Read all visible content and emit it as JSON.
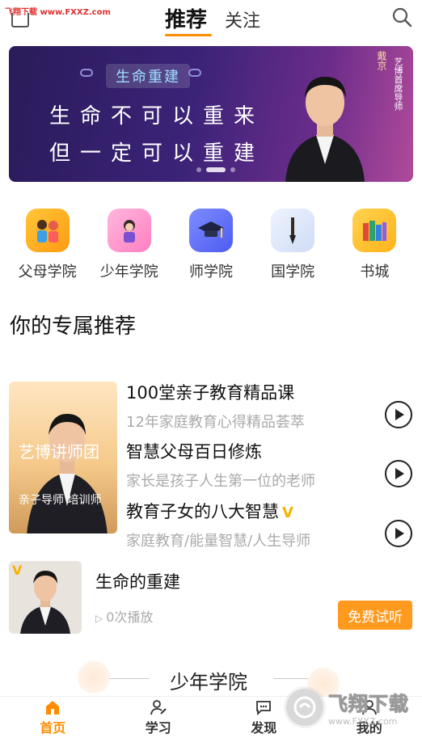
{
  "watermark_top": "飞翔下载 www.FXXZ.com",
  "watermark_bottom": {
    "title": "飞翔下载",
    "url": "www.FXXZ.com"
  },
  "header": {
    "tab_active": "推荐",
    "tab_follow": "关注"
  },
  "banner": {
    "pill": "生命重建",
    "line1": "生命不可以重来",
    "line2": "但一定可以重建",
    "side_name": "戴京",
    "side_title": "艺博首席导师",
    "dots": 3,
    "active_dot": 1
  },
  "categories": [
    {
      "label": "父母学院",
      "icon": "parents-icon",
      "color": "#ffb21e"
    },
    {
      "label": "少年学院",
      "icon": "teen-icon",
      "color": "#ff9ad0"
    },
    {
      "label": "师学院",
      "icon": "graduation-cap-icon",
      "color": "#6a7bff"
    },
    {
      "label": "国学院",
      "icon": "brush-icon",
      "color": "#dce9ff"
    },
    {
      "label": "书城",
      "icon": "books-icon",
      "color": "#ffc53a"
    }
  ],
  "recommend": {
    "title": "你的专属推荐",
    "teacher": {
      "name": "艺博讲师团",
      "desc": "亲子导师 培训师"
    },
    "courses": [
      {
        "title": "100堂亲子教育精品课",
        "subtitle": "12年家庭教育心得精品荟萃",
        "vip": ""
      },
      {
        "title": "智慧父母百日修炼",
        "subtitle": "家长是孩子人生第一位的老师",
        "vip": ""
      },
      {
        "title": "教育子女的八大智慧",
        "subtitle": "家庭教育/能量智慧/人生导师",
        "vip": "V"
      }
    ]
  },
  "life_course": {
    "badge": "V",
    "title": "生命的重建",
    "plays": "0次播放",
    "trial_button": "免费试听"
  },
  "sub_section_title": "少年学院",
  "bottom_nav": [
    {
      "label": "首页",
      "icon": "home-icon",
      "active": true
    },
    {
      "label": "学习",
      "icon": "study-icon",
      "active": false
    },
    {
      "label": "发现",
      "icon": "discover-icon",
      "active": false
    },
    {
      "label": "我的",
      "icon": "profile-icon",
      "active": false
    }
  ],
  "colors": {
    "accent": "#ff8c00",
    "trial": "#ff9a1f",
    "vip": "#f5b200"
  }
}
